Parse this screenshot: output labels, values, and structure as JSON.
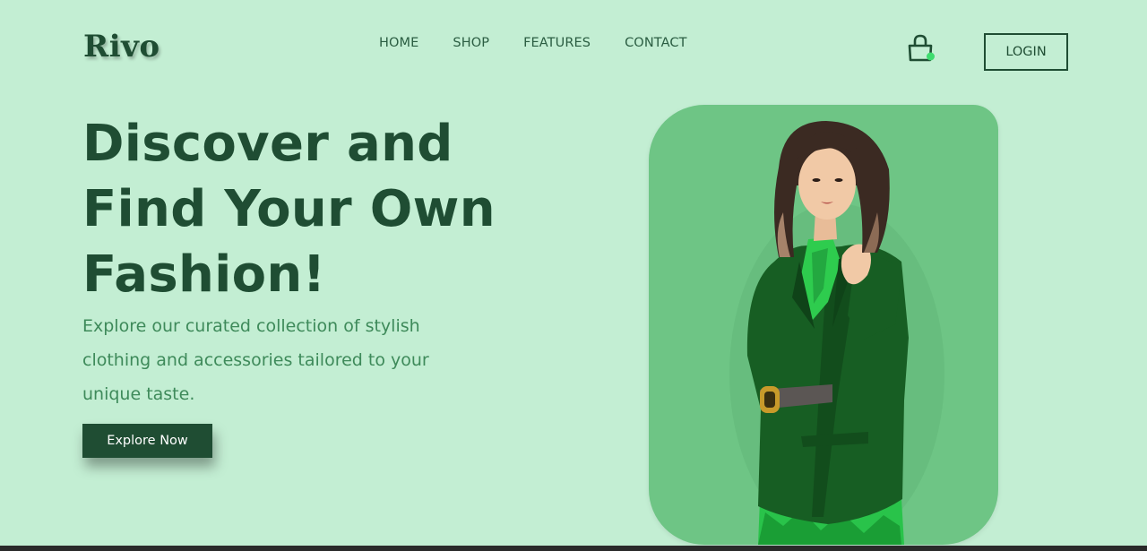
{
  "brand": {
    "logo": "Rivo"
  },
  "nav": {
    "items": [
      {
        "label": "HOME"
      },
      {
        "label": "SHOP"
      },
      {
        "label": "FEATURES"
      },
      {
        "label": "CONTACT"
      }
    ]
  },
  "header": {
    "cart_icon": "shopping-bag-icon",
    "cart_indicator_color": "#3ddc6e",
    "login_label": "LOGIN"
  },
  "hero": {
    "headline_lines": [
      "Discover and",
      "Find Your Own",
      "Fashion!"
    ],
    "description_lines": [
      "Explore our curated collection of stylish",
      "clothing and accessories tailored to your",
      "unique taste."
    ],
    "cta_label": "Explore Now"
  },
  "colors": {
    "background": "#c3eed3",
    "primary_dark": "#1f4d33",
    "card_green": "#6ec585",
    "text_green": "#3e8a5a"
  }
}
